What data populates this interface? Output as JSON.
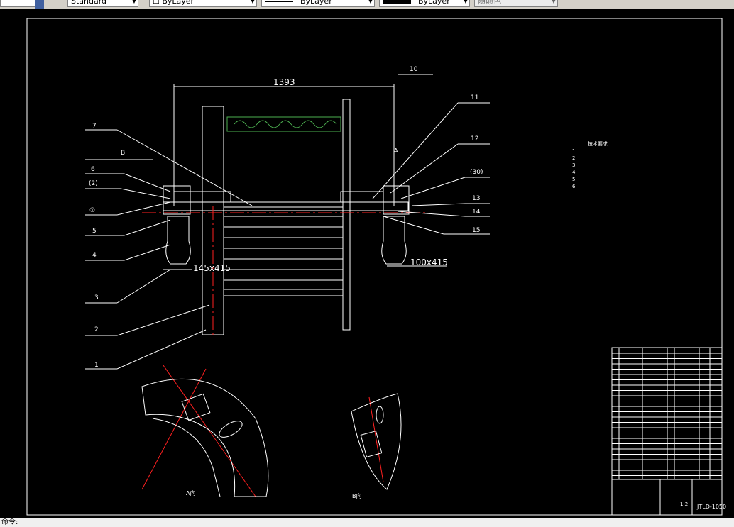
{
  "toolbar": {
    "textstyle": "Standard",
    "layer": "ByLayer",
    "linetype": "ByLayer",
    "lineweight": "ByLayer",
    "plotstyle": "随颜色"
  },
  "drawing": {
    "dim_width": "1393",
    "dim_left_bolt": "145x415",
    "dim_right_bolt": "100x415",
    "left_labels": [
      "7",
      "B",
      "6",
      "(2)",
      "①",
      "5",
      "4",
      "3",
      "2",
      "1"
    ],
    "right_labels": [
      "10",
      "11",
      "12",
      "(30)",
      "13",
      "14",
      "15"
    ],
    "view_a": "A向",
    "view_b": "B向",
    "section_a": "A",
    "notes_title": "技术要求",
    "notes": [
      "1.",
      "2.",
      "3.",
      "4.",
      "5.",
      "6."
    ],
    "drawing_no": "JTLD-1050",
    "scale": "1:2"
  },
  "command": {
    "prompt": "命令:"
  },
  "colors": {
    "red": "#ff2020",
    "green": "#4caf50",
    "frame": "#ffffff",
    "border": "#1a1a8c"
  }
}
